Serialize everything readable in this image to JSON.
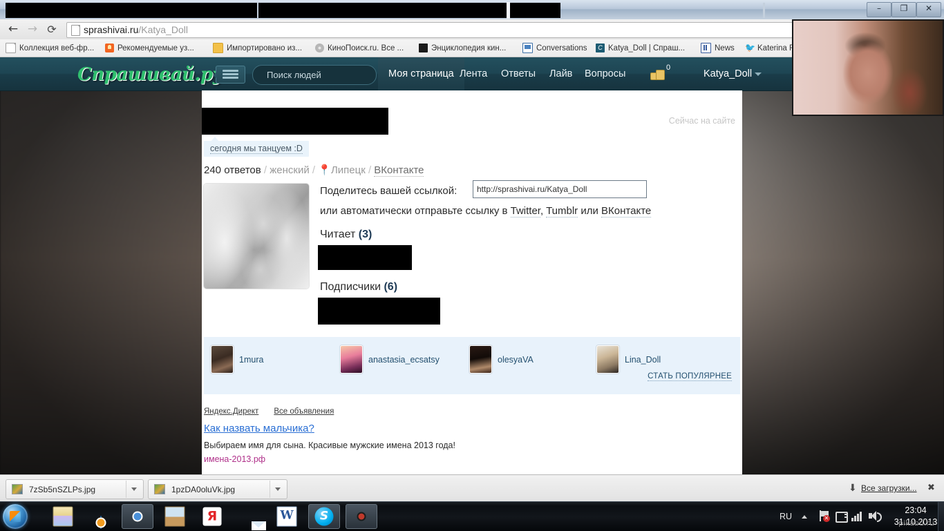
{
  "window": {
    "minimize": "–",
    "maximize": "❐",
    "close": "✕"
  },
  "browser": {
    "back_icon": "←",
    "forward_icon": "→",
    "reload_icon": "⟳",
    "url_domain": "sprashivai.ru",
    "url_path": "/Katya_Doll",
    "bookmarks": [
      {
        "label": "Коллекция веб-фр...",
        "icon": "document-icon"
      },
      {
        "label": "Рекомендуемые уз...",
        "icon": "bulb-icon"
      },
      {
        "label": "Импортировано из...",
        "icon": "folder-icon"
      },
      {
        "label": "КиноПоиск.ru. Все ...",
        "icon": "kinopoisk-icon"
      },
      {
        "label": "Энциклопедия кин...",
        "icon": "film-icon"
      },
      {
        "label": "Conversations",
        "icon": "conversations-icon"
      },
      {
        "label": "Katya_Doll | Спраш...",
        "icon": "sprashivai-icon"
      },
      {
        "label": "News",
        "icon": "news-icon"
      },
      {
        "label": "Katerina F",
        "icon": "twitter-icon"
      }
    ]
  },
  "site": {
    "logo": "Спрашивай.ру",
    "messages_icon": "messages-icon",
    "search_placeholder": "Поиск людей",
    "nav": {
      "my_page": "Моя страница",
      "feed": "Лента",
      "answers": "Ответы",
      "live": "Лайв",
      "questions": "Вопросы"
    },
    "coins_count": "0",
    "username": "Katya_Doll"
  },
  "profile": {
    "online_label": "Сейчас на сайте",
    "status": "сегодня мы танцуем :D",
    "answers_count": "240 ответов",
    "gender": "женский",
    "city": "Липецк",
    "social": "ВКонтакте",
    "share_label": "Поделитесь вашей ссылкой:",
    "share_url": "http://sprashivai.ru/Katya_Doll",
    "share_line2_pre": "или автоматически отправьте ссылку в ",
    "share_twitter": "Twitter",
    "share_tumblr": "Tumblr",
    "share_or": " или ",
    "share_vk": "ВКонтакте",
    "reads_label": "Читает",
    "reads_count": "(3)",
    "subs_label": "Подписчики",
    "subs_count": "(6)"
  },
  "popular": {
    "users": [
      {
        "name": "1mura"
      },
      {
        "name": "anastasia_ecsatsy"
      },
      {
        "name": "olesyaVA"
      },
      {
        "name": "Lina_Doll"
      }
    ],
    "cta": "СТАТЬ ПОПУЛЯРНЕЕ"
  },
  "ads": {
    "provider": "Яндекс.Директ",
    "all_ads": "Все объявления",
    "title": "Как назвать мальчика?",
    "description": "Выбираем имя для сына. Красивые мужские имена 2013 года!",
    "url": "имена-2013.рф"
  },
  "downloads": {
    "items": [
      {
        "filename": "7zSb5nSZLPs.jpg"
      },
      {
        "filename": "1pzDA0oluVk.jpg"
      }
    ],
    "all_downloads": "Все загрузки...",
    "close_icon": "✖",
    "arrow_icon": "⬇"
  },
  "taskbar": {
    "start_icon": "windows-start-icon",
    "items": [
      {
        "name": "explorer",
        "icon": "folder-icon"
      },
      {
        "name": "media-player",
        "icon": "media-player-icon"
      },
      {
        "name": "chrome",
        "icon": "chrome-icon"
      },
      {
        "name": "toolbox",
        "icon": "toolbox-icon"
      },
      {
        "name": "yandex",
        "icon": "yandex-icon",
        "glyph": "Я"
      },
      {
        "name": "mail",
        "icon": "mail-icon"
      },
      {
        "name": "word",
        "icon": "word-icon",
        "glyph": "W"
      },
      {
        "name": "skype",
        "icon": "skype-icon",
        "glyph": "S"
      },
      {
        "name": "webcam",
        "icon": "webcam-icon"
      }
    ],
    "tray": {
      "language": "RU",
      "time": "23:04",
      "date": "31.10.2013",
      "watermark": "pikabu.ru"
    }
  }
}
